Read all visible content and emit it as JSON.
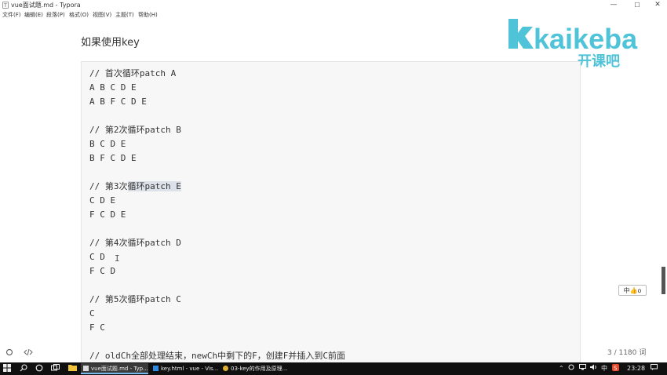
{
  "window": {
    "title": "vue面试题.md - Typora",
    "app_icon": "T",
    "controls": {
      "minimize": "—",
      "maximize": "☐",
      "close": "✕"
    }
  },
  "menu": [
    "文件(F)",
    "编辑(E)",
    "段落(P)",
    "格式(O)",
    "视图(V)",
    "主题(T)",
    "帮助(H)"
  ],
  "doc": {
    "heading": "如果使用key",
    "code_lines": [
      "// 首次循环patch A",
      "A B C D E",
      "A B F C D E",
      "",
      "// 第2次循环patch B",
      "B C D E",
      "B F C D E",
      "",
      "// 第3次循环patch E",
      "C D E",
      "F C D E",
      "",
      "// 第4次循环patch D",
      "C D",
      "F C D",
      "",
      "// 第5次循环patch C",
      "C",
      "F C",
      "",
      "// oldCh全部处理结束，newCh中剩下的F，创建F并插入到C前面"
    ],
    "highlight": {
      "line_prefix": "// 第3次",
      "text": "循环patch E"
    }
  },
  "logo": {
    "brand": "kaikeba",
    "tagline": "开课吧",
    "color": "#4fc3d8"
  },
  "status": {
    "word_count": "3 / 1180 词",
    "left_icons": [
      "circle-icon",
      "code-icon"
    ]
  },
  "ime_badge": "中👍o",
  "taskbar": {
    "tasks": [
      {
        "label": "vue面试题.md - Typ...",
        "active": true
      },
      {
        "label": "key.html - vue - Vis...",
        "active": false
      },
      {
        "label": "03-key的作用及原理...",
        "active": false
      }
    ],
    "tray": {
      "ime": "中",
      "clock": "23:28",
      "notifications": "💬"
    }
  },
  "colors": {
    "accent": "#76b9ed",
    "code_bg": "#f7f7f7",
    "highlight": "#dde2ea"
  }
}
